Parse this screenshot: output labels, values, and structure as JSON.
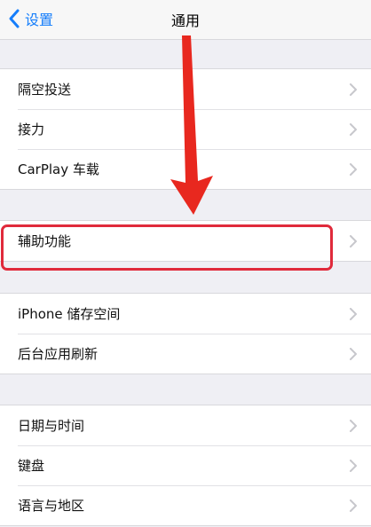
{
  "nav": {
    "back_label": "设置",
    "title": "通用"
  },
  "groups": [
    {
      "items": [
        {
          "label": "隔空投送"
        },
        {
          "label": "接力"
        },
        {
          "label": "CarPlay 车载"
        }
      ]
    },
    {
      "items": [
        {
          "label": "辅助功能"
        }
      ]
    },
    {
      "items": [
        {
          "label": "iPhone 储存空间"
        },
        {
          "label": "后台应用刷新"
        }
      ]
    },
    {
      "items": [
        {
          "label": "日期与时间"
        },
        {
          "label": "键盘"
        },
        {
          "label": "语言与地区"
        }
      ]
    }
  ],
  "colors": {
    "accent": "#157efb",
    "annotation": "#e02a3b",
    "background": "#efeff4"
  },
  "icons": [
    "back-chevron-icon",
    "chevron-right-icon",
    "down-arrow-icon"
  ]
}
